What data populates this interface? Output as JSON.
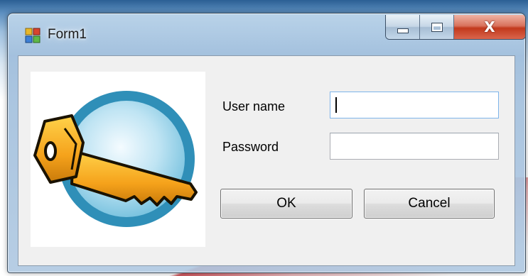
{
  "window": {
    "title": "Form1",
    "close_glyph": "X"
  },
  "form": {
    "username_label": "User name",
    "username_value": "",
    "password_label": "Password",
    "password_value": "",
    "ok_label": "OK",
    "cancel_label": "Cancel"
  },
  "icons": {
    "app": "form-app-icon",
    "picture": "key-icon"
  },
  "colors": {
    "close_button": "#c2391c",
    "key_gold": "#f5a21b",
    "disc_blue": "#2f8fb8"
  }
}
